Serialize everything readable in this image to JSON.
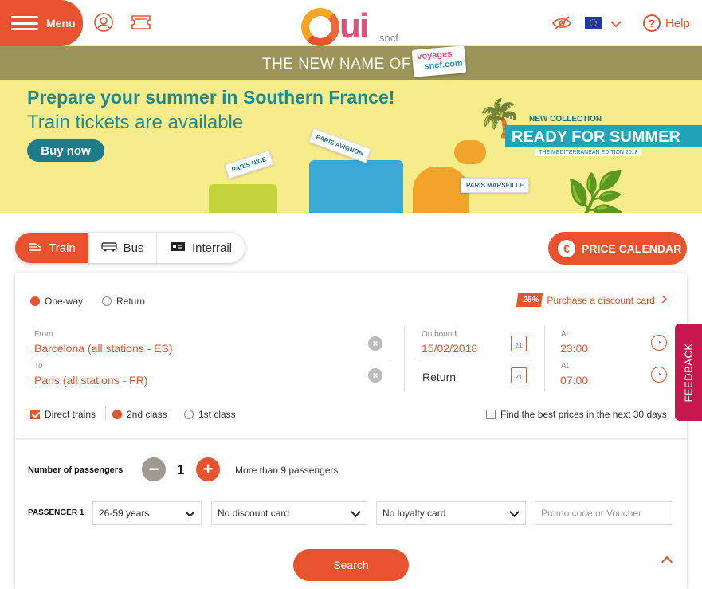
{
  "header": {
    "menu_label": "Menu",
    "logo_text": "Oui",
    "logo_sub": "sncf",
    "help_label": "Help",
    "help_glyph": "?"
  },
  "banner": {
    "top_text": "THE NEW NAME OF",
    "voyages_line1": "voyages",
    "voyages_line2": "sncf.com",
    "headline": "Prepare your summer in Southern France!",
    "subheadline": "Train tickets are available",
    "buy_label": "Buy now",
    "new_collection": "NEW COLLECTION",
    "ready": "READY FOR SUMMER",
    "edition": "THE MEDITERRANEAN EDITION 2018",
    "tags": [
      "PARIS NICE",
      "PARIS AVIGNON",
      "PARIS MARSEILLE"
    ]
  },
  "modes": {
    "train": "Train",
    "bus": "Bus",
    "interrail": "Interrail"
  },
  "price_calendar": {
    "label": "PRICE CALENDAR",
    "symbol": "€"
  },
  "form": {
    "trip_one_way": "One-way",
    "trip_return": "Return",
    "discount_badge": "-25%",
    "discount_label": "Purchase a discount card",
    "from_label": "From",
    "from_value": "Barcelona (all stations - ES)",
    "to_label": "To",
    "to_value": "Paris (all stations - FR)",
    "outbound_label": "Outbound",
    "outbound_value": "15/02/2018",
    "return_label": "Return",
    "at_label_1": "At",
    "at_value_1": "23:00",
    "at_label_2": "At",
    "at_value_2": "07:00",
    "cal_day": "21",
    "direct_trains": "Direct trains",
    "second_class": "2nd class",
    "first_class": "1st class",
    "best_prices": "Find the best prices in the next 30 days",
    "passengers_label": "Number of passengers",
    "passenger_count": "1",
    "more_than_9": "More than 9 passengers",
    "passenger1_label": "PASSENGER 1",
    "age_value": "26-59 years",
    "discount_card_value": "No discount card",
    "loyalty_value": "No loyalty card",
    "promo_placeholder": "Promo code or Voucher",
    "search_label": "Search"
  },
  "feedback_label": "FEEDBACK",
  "colors": {
    "accent": "#e8532f",
    "banner_olive": "#9d9459",
    "banner_yellow": "#f7ec8c",
    "teal": "#1e8a8c",
    "feedback": "#c8174c"
  }
}
